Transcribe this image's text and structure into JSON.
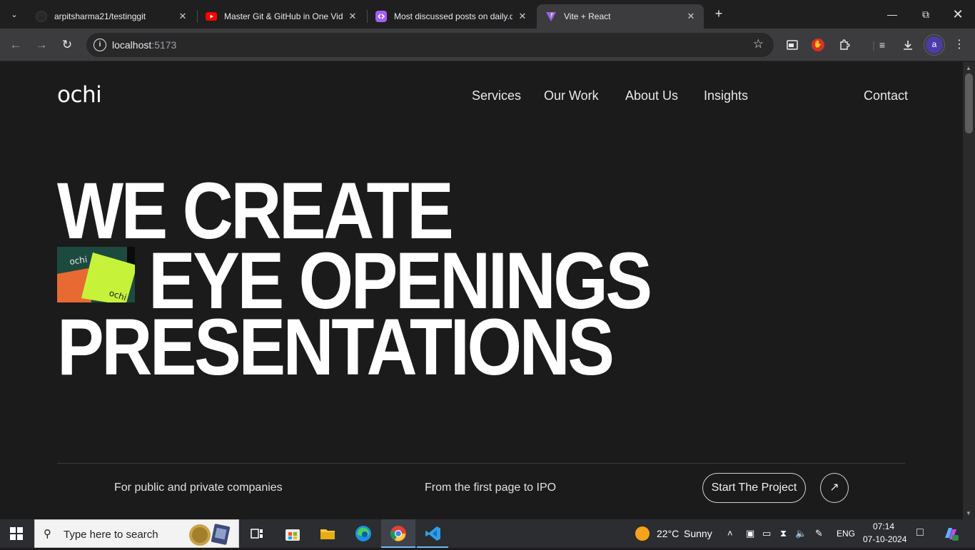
{
  "browser": {
    "tabs": [
      {
        "title": "arpitsharma21/testinggit",
        "icon": "github-icon"
      },
      {
        "title": "Master Git & GitHub in One Vid",
        "icon": "youtube-icon"
      },
      {
        "title": "Most discussed posts on daily.d",
        "icon": "dailydev-icon"
      },
      {
        "title": "Vite + React",
        "icon": "vite-icon",
        "active": true
      }
    ],
    "address": {
      "host": "localhost",
      "port": ":5173"
    },
    "profile_initial": "a"
  },
  "site": {
    "logo": "ochi",
    "nav": [
      "Services",
      "Our Work",
      "About Us",
      "Insights"
    ],
    "contact": "Contact",
    "hero": {
      "line1": "WE CREATE",
      "line2": "EYE OPENINGS",
      "line3": "PRESENTATIONS",
      "image_label": "ochi"
    },
    "footer": {
      "tag1": "For public and private companies",
      "tag2": "From the first page to IPO",
      "cta": "Start The Project",
      "cta_icon": "arrow-up-right-icon"
    }
  },
  "taskbar": {
    "search_placeholder": "Type here to search",
    "weather": {
      "temp": "22°C",
      "condition": "Sunny"
    },
    "language": "ENG",
    "time": "07:14",
    "date": "07-10-2024"
  },
  "colors": {
    "page_bg": "#1b1b1c",
    "hero_image_green": "#c7f23a",
    "hero_image_orange": "#e86a33",
    "vscode_blue": "#2f9fe8",
    "avatar": "#4b3ca8"
  }
}
